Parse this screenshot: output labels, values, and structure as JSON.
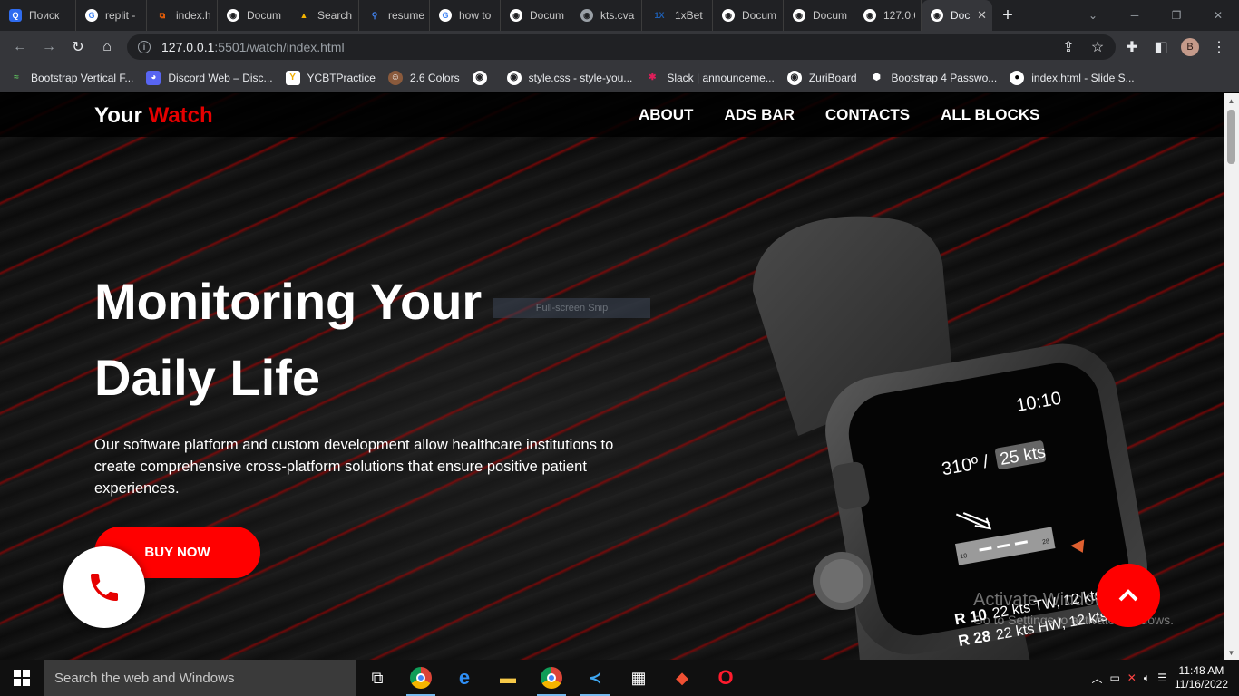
{
  "browser": {
    "tabs": [
      {
        "title": "Поиск",
        "icon": "yandex-icon"
      },
      {
        "title": "replit -",
        "icon": "google-icon"
      },
      {
        "title": "index.h",
        "icon": "replit-icon"
      },
      {
        "title": "Docum",
        "icon": "globe-icon"
      },
      {
        "title": "Search",
        "icon": "drive-icon"
      },
      {
        "title": "resume",
        "icon": "search-icon"
      },
      {
        "title": "how to",
        "icon": "google-icon"
      },
      {
        "title": "Docum",
        "icon": "globe-icon"
      },
      {
        "title": "kts.cva",
        "icon": "globe-icon"
      },
      {
        "title": "1xBet",
        "icon": "1xbet-icon"
      },
      {
        "title": "Docum",
        "icon": "globe-icon"
      },
      {
        "title": "Docum",
        "icon": "globe-icon"
      },
      {
        "title": "127.0.0",
        "icon": "globe-icon"
      },
      {
        "title": "Doc",
        "icon": "globe-icon",
        "active": true
      }
    ],
    "new_tab": "+",
    "url_host": "127.0.0.1",
    "url_path": ":5501/watch/index.html",
    "profile_initial": "B",
    "bookmarks": [
      {
        "label": "Bootstrap Vertical F...",
        "icon": "bootstrap-icon"
      },
      {
        "label": "Discord Web – Disc...",
        "icon": "discord-icon"
      },
      {
        "label": "YCBTPractice",
        "icon": "yc-icon"
      },
      {
        "label": "2.6 Colors",
        "icon": "avatar-icon"
      },
      {
        "label": "",
        "icon": "globe-icon"
      },
      {
        "label": "style.css - style-you...",
        "icon": "globe-icon"
      },
      {
        "label": "Slack | announceme...",
        "icon": "slack-icon"
      },
      {
        "label": "ZuriBoard",
        "icon": "globe-icon"
      },
      {
        "label": "Bootstrap 4 Passwo...",
        "icon": "codepen-icon"
      },
      {
        "label": "index.html - Slide S...",
        "icon": "github-icon"
      }
    ]
  },
  "site": {
    "logo_main": "Your",
    "logo_accent": "Watch",
    "nav": [
      "ABOUT",
      "ADS BAR",
      "CONTACTS",
      "ALL BLOCKS"
    ],
    "hero_title_line1": "Monitoring Your",
    "hero_title_line2": "Daily Life",
    "hero_text": "Our software platform and custom development allow healthcare institutions to create comprehensive cross-platform solutions that ensure positive patient experiences.",
    "buy_label": "BUY NOW",
    "watch_screen": {
      "time": "10:10",
      "heading": "310º /",
      "wind": "25 kts",
      "runway_left": "10",
      "runway_right": "28",
      "r10_label": "R 10",
      "r10_text": "22 kts TW, 12 kts XW",
      "r28_label": "R 28",
      "r28_text": "22 kts HW, 12 kts XW"
    },
    "accent_color": "#ff0000"
  },
  "overlay": {
    "snip_label": "Full-screen Snip",
    "activate_title": "Activate Windows",
    "activate_sub": "Go to Settings to activate Windows."
  },
  "taskbar": {
    "search_placeholder": "Search the web and Windows",
    "time": "11:48 AM",
    "date": "11/16/2022"
  }
}
